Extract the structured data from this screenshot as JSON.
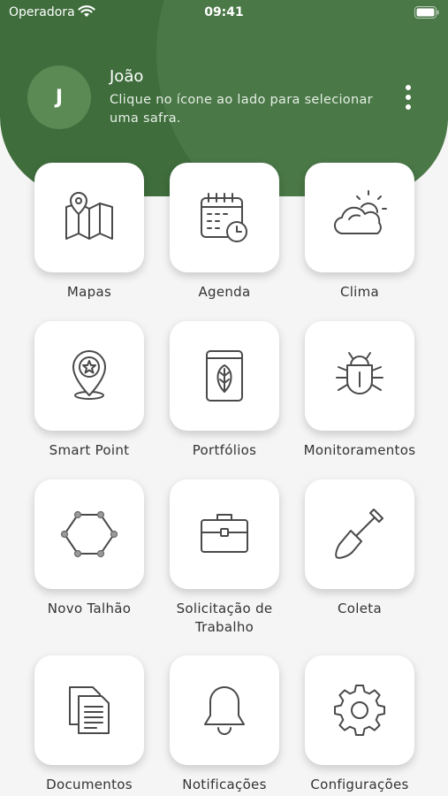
{
  "status_bar": {
    "carrier": "Operadora",
    "time": "09:41"
  },
  "profile": {
    "initial": "J",
    "name": "João",
    "hint": "Clique no ícone ao lado para selecionar uma safra."
  },
  "menu": {
    "items": [
      {
        "label": "Mapas",
        "icon": "map-icon"
      },
      {
        "label": "Agenda",
        "icon": "calendar-icon"
      },
      {
        "label": "Clima",
        "icon": "weather-icon"
      },
      {
        "label": "Smart Point",
        "icon": "location-star-icon"
      },
      {
        "label": "Portfólios",
        "icon": "leaf-book-icon"
      },
      {
        "label": "Monitoramentos",
        "icon": "bug-icon"
      },
      {
        "label": "Novo Talhão",
        "icon": "hexagon-icon"
      },
      {
        "label": "Solicitação de Trabalho",
        "icon": "briefcase-icon"
      },
      {
        "label": "Coleta",
        "icon": "shovel-icon"
      },
      {
        "label": "Documentos",
        "icon": "documents-icon"
      },
      {
        "label": "Notificações",
        "icon": "bell-icon"
      },
      {
        "label": "Configurações",
        "icon": "gear-icon"
      }
    ]
  },
  "colors": {
    "header": "#3f6d3c",
    "avatar": "#5b8a55",
    "icon_stroke": "#4a4a4a",
    "background": "#f5f5f5"
  }
}
